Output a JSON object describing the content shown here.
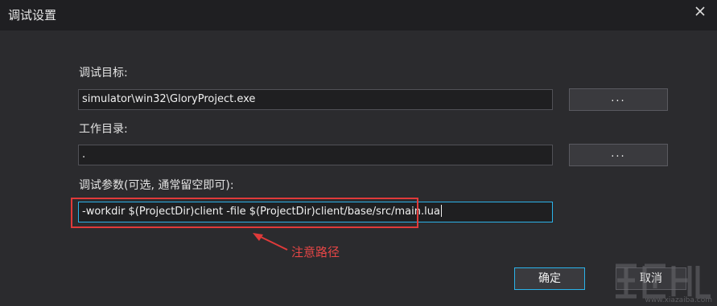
{
  "window": {
    "title": "调试设置",
    "close_icon": "close-icon"
  },
  "fields": {
    "target": {
      "label": "调试目标:",
      "value": "simulator\\win32\\GloryProject.exe",
      "browse_label": "..."
    },
    "workdir": {
      "label": "工作目录:",
      "value": ".",
      "browse_label": "..."
    },
    "args": {
      "label": "调试参数(可选, 通常留空即可):",
      "value": "-workdir $(ProjectDir)client -file $(ProjectDir)client/base/src/main.lua"
    }
  },
  "annotation": {
    "text": "注意路径",
    "color": "#e03a3a"
  },
  "buttons": {
    "ok": "确定",
    "cancel": "取消"
  },
  "colors": {
    "focus_border": "#2bb3ea",
    "background": "#2b2b2e",
    "titlebar": "#1f1f22"
  },
  "watermark": {
    "url": "www.xiazaiba.com"
  }
}
